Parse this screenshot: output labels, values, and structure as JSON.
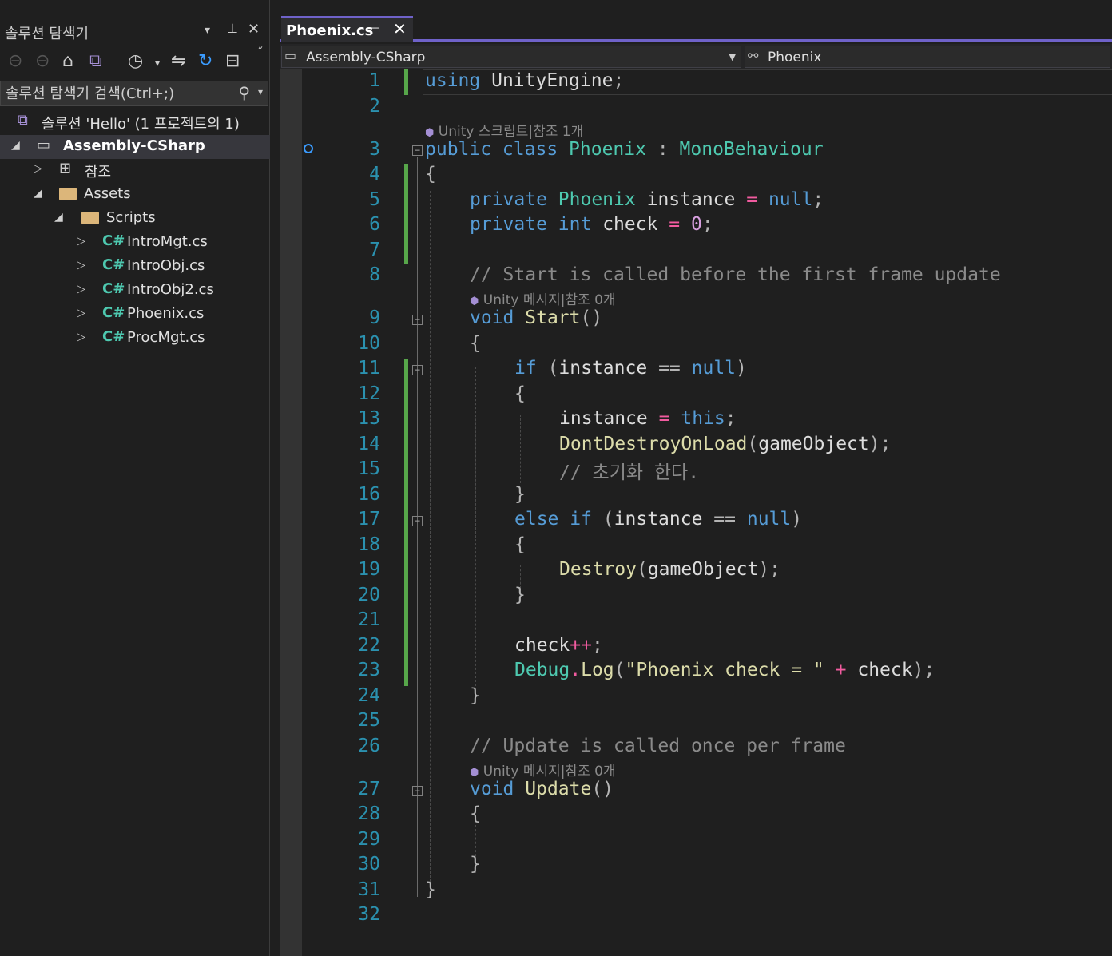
{
  "explorer": {
    "title": "솔루션 탐색기",
    "controls": {
      "dropdown": "▾",
      "pin": "📌",
      "close": "✕"
    },
    "search_placeholder": "솔루션 탐색기 검색(Ctrl+;)",
    "solution_label": "솔루션 'Hello' (1 프로젝트의 1)",
    "project_label": "Assembly-CSharp",
    "references_label": "참조",
    "assets_label": "Assets",
    "scripts_label": "Scripts",
    "files": [
      "IntroMgt.cs",
      "IntroObj.cs",
      "IntroObj2.cs",
      "Phoenix.cs",
      "ProcMgt.cs"
    ],
    "cs_icon_text": "C#"
  },
  "editor": {
    "tab_name": "Phoenix.cs",
    "tab_pin": "⊣",
    "tab_close": "✕",
    "nav_project": "Assembly-CSharp",
    "nav_class": "Phoenix",
    "lens": {
      "class_refs": "Unity 스크립트|참조 1개",
      "start_refs": "Unity 메시지|참조 0개",
      "update_refs": "Unity 메시지|참조 0개"
    },
    "line_numbers": [
      "1",
      "2",
      "3",
      "4",
      "5",
      "6",
      "7",
      "8",
      "9",
      "10",
      "11",
      "12",
      "13",
      "14",
      "15",
      "16",
      "17",
      "18",
      "19",
      "20",
      "21",
      "22",
      "23",
      "24",
      "25",
      "26",
      "27",
      "28",
      "29",
      "30",
      "31",
      "32"
    ]
  },
  "code": {
    "l1_kw": "using",
    "l1_ns": "UnityEngine",
    "l3_kw": "public class",
    "l3_name": "Phoenix",
    "l3_base": "MonoBehaviour",
    "l5_kw": "private",
    "l5_type": "Phoenix",
    "l5_var": "instance",
    "l5_null": "null",
    "l6_kw": "private int",
    "l6_var": "check",
    "l6_num": "0",
    "l8_comment": "// Start is called before the first frame update",
    "l9_kw": "void",
    "l9_fn": "Start",
    "l11_kw": "if",
    "l11_var": "instance",
    "l11_null": "null",
    "l13_var": "instance",
    "l13_this": "this",
    "l14_fn": "DontDestroyOnLoad",
    "l14_arg": "gameObject",
    "l15_comment": "// 초기화 한다.",
    "l17_kw": "else if",
    "l17_var": "instance",
    "l17_null": "null",
    "l19_fn": "Destroy",
    "l19_arg": "gameObject",
    "l22_var": "check",
    "l23_cls": "Debug",
    "l23_fn": "Log",
    "l23_str": "\"Phoenix check = \"",
    "l23_var": "check",
    "l26_comment": "// Update is called once per frame",
    "l27_kw": "void",
    "l27_fn": "Update"
  }
}
